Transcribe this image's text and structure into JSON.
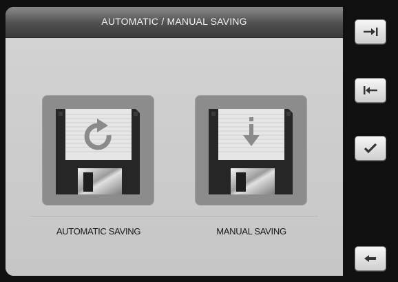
{
  "window": {
    "title": "AUTOMATIC / MANUAL SAVING"
  },
  "options": [
    {
      "label": "AUTOMATIC SAVING",
      "icon": "floppy-disk-refresh-icon"
    },
    {
      "label": "MANUAL SAVING",
      "icon": "floppy-disk-download-icon"
    }
  ],
  "sidebar": {
    "buttons": [
      {
        "icon": "arrow-right-to-bar-icon"
      },
      {
        "icon": "arrow-left-from-bar-icon"
      },
      {
        "icon": "checkmark-icon"
      },
      {
        "icon": "back-arrow-icon"
      }
    ]
  },
  "colors": {
    "titlebar": "#4f4f4f",
    "screen": "#cfcfcf",
    "tile": "#8c8c8c",
    "sidebar": "#101010"
  }
}
